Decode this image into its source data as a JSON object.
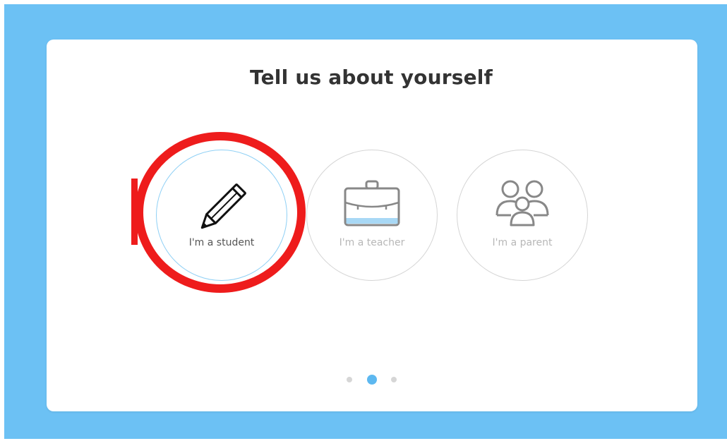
{
  "page": {
    "title": "Tell us about yourself",
    "background_color": "#6cc1f4",
    "card_color": "#ffffff",
    "accent_color": "#5db8f0",
    "annotation_color": "#ee1c1c"
  },
  "options": [
    {
      "label": "I'm a student",
      "icon": "pencil-icon",
      "selected": true
    },
    {
      "label": "I'm a teacher",
      "icon": "briefcase-icon",
      "selected": false
    },
    {
      "label": "I'm a parent",
      "icon": "family-icon",
      "selected": false
    }
  ],
  "pagination": {
    "total": 3,
    "active": 2
  }
}
